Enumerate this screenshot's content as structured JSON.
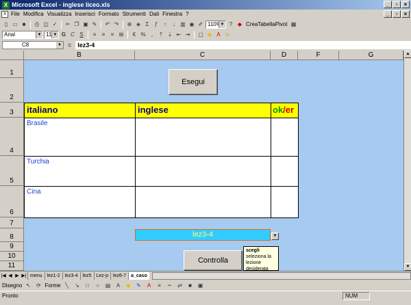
{
  "window": {
    "title": "Microsoft Excel - inglese liceo.xls",
    "app_icon": "X",
    "buttons": [
      "_",
      "×",
      "×"
    ]
  },
  "menubar": {
    "items": [
      "File",
      "Modifica",
      "Visualizza",
      "Inserisci",
      "Formato",
      "Strumenti",
      "Dati",
      "Finestra",
      "?"
    ]
  },
  "toolbar": {
    "zoom": "110%",
    "pivot_label": "CreaTabellaPivot"
  },
  "format_toolbar": {
    "font": "Arial",
    "size": "11",
    "bold": "G",
    "italic": "C",
    "underline": "S",
    "percent": "%"
  },
  "formula_bar": {
    "name_box": "C8",
    "equals": "=",
    "value": "lez3-4"
  },
  "columns": [
    "B",
    "C",
    "D",
    "F",
    "G"
  ],
  "rows": [
    "1",
    "2",
    "3",
    "4",
    "5",
    "6",
    "7",
    "8",
    "9",
    "10",
    "11"
  ],
  "sheet": {
    "run_button": "Esegui",
    "headers": {
      "italian": "italiano",
      "english": "inglese",
      "ok": "ok",
      "slash": "/",
      "er": "er"
    },
    "countries": [
      "Brasile",
      "Turchia",
      "Cina"
    ],
    "dropdown_value": "lez3-4",
    "check_button": "Controlla",
    "tooltip": {
      "title": "scegli",
      "text1": "seleziona la",
      "text2": "lezione",
      "text3": "desiderata"
    }
  },
  "tabs": [
    "menu",
    "lez1-2",
    "lez3-4",
    "lez5",
    "Lez-p",
    "lez6-7",
    "a_caso"
  ],
  "active_tab": "a_caso",
  "drawbar": {
    "drawing": "Disegno",
    "forms": "Forme"
  },
  "status": {
    "ready": "Pronto",
    "num": "NUM"
  },
  "colors": {
    "header_yellow": "#ffff00",
    "sheet_bg": "#a6caf0",
    "dropdown_bg": "#33ccff"
  }
}
